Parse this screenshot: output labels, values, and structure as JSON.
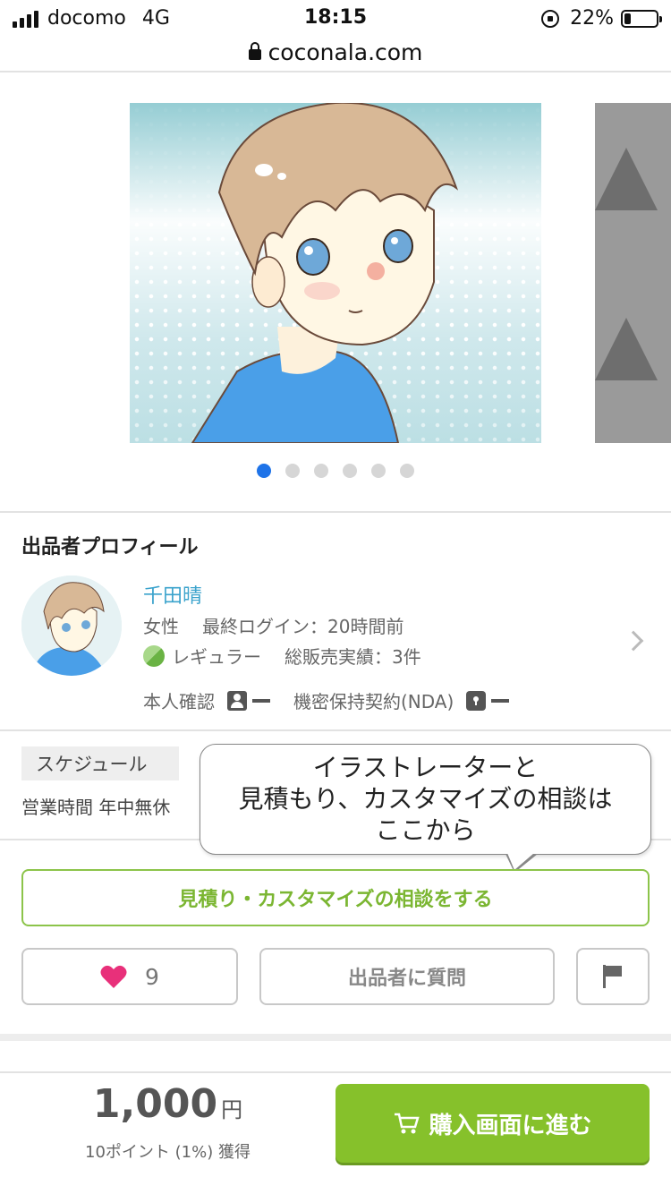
{
  "status_bar": {
    "carrier": "docomo",
    "network": "4G",
    "time": "18:15",
    "battery": "22%",
    "battery_level": 0.22
  },
  "url_bar": {
    "domain": "coconala.com"
  },
  "carousel": {
    "slide_count": 6,
    "active_index": 0
  },
  "profile": {
    "section_title": "出品者プロフィール",
    "name": "千田晴",
    "gender": "女性",
    "last_login": "最終ログイン：20時間前",
    "rank": "レギュラー",
    "sales": "総販売実績：3件",
    "identity_label": "本人確認",
    "nda_label": "機密保持契約(NDA)"
  },
  "schedule": {
    "tag": "スケジュール",
    "hours": "営業時間 年中無休"
  },
  "tooltip": {
    "line1": "イラストレーターと",
    "line2": "見積もり、カスタマイズの相談は",
    "line3": "ここから"
  },
  "actions": {
    "consult_label": "見積り・カスタマイズの相談をする",
    "like_count": "9",
    "question_label": "出品者に質問"
  },
  "purchase": {
    "price": "1,000",
    "currency": "円",
    "points": "10ポイント (1%) 獲得",
    "buy_label": "購入画面に進む"
  },
  "colors": {
    "accent_green": "#86c12b",
    "link_blue": "#3ba3cc",
    "heart_pink": "#e8307a",
    "dot_active": "#1e73e8"
  }
}
